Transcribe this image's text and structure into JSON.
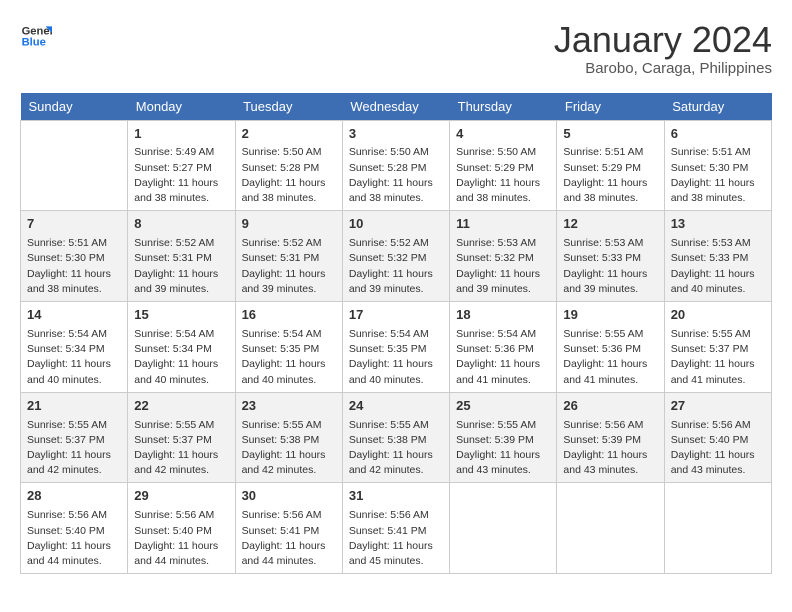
{
  "header": {
    "logo_line1": "General",
    "logo_line2": "Blue",
    "title": "January 2024",
    "subtitle": "Barobo, Caraga, Philippines"
  },
  "weekdays": [
    "Sunday",
    "Monday",
    "Tuesday",
    "Wednesday",
    "Thursday",
    "Friday",
    "Saturday"
  ],
  "weeks": [
    [
      {
        "day": "",
        "info": ""
      },
      {
        "day": "1",
        "info": "Sunrise: 5:49 AM\nSunset: 5:27 PM\nDaylight: 11 hours\nand 38 minutes."
      },
      {
        "day": "2",
        "info": "Sunrise: 5:50 AM\nSunset: 5:28 PM\nDaylight: 11 hours\nand 38 minutes."
      },
      {
        "day": "3",
        "info": "Sunrise: 5:50 AM\nSunset: 5:28 PM\nDaylight: 11 hours\nand 38 minutes."
      },
      {
        "day": "4",
        "info": "Sunrise: 5:50 AM\nSunset: 5:29 PM\nDaylight: 11 hours\nand 38 minutes."
      },
      {
        "day": "5",
        "info": "Sunrise: 5:51 AM\nSunset: 5:29 PM\nDaylight: 11 hours\nand 38 minutes."
      },
      {
        "day": "6",
        "info": "Sunrise: 5:51 AM\nSunset: 5:30 PM\nDaylight: 11 hours\nand 38 minutes."
      }
    ],
    [
      {
        "day": "7",
        "info": "Sunrise: 5:51 AM\nSunset: 5:30 PM\nDaylight: 11 hours\nand 38 minutes."
      },
      {
        "day": "8",
        "info": "Sunrise: 5:52 AM\nSunset: 5:31 PM\nDaylight: 11 hours\nand 39 minutes."
      },
      {
        "day": "9",
        "info": "Sunrise: 5:52 AM\nSunset: 5:31 PM\nDaylight: 11 hours\nand 39 minutes."
      },
      {
        "day": "10",
        "info": "Sunrise: 5:52 AM\nSunset: 5:32 PM\nDaylight: 11 hours\nand 39 minutes."
      },
      {
        "day": "11",
        "info": "Sunrise: 5:53 AM\nSunset: 5:32 PM\nDaylight: 11 hours\nand 39 minutes."
      },
      {
        "day": "12",
        "info": "Sunrise: 5:53 AM\nSunset: 5:33 PM\nDaylight: 11 hours\nand 39 minutes."
      },
      {
        "day": "13",
        "info": "Sunrise: 5:53 AM\nSunset: 5:33 PM\nDaylight: 11 hours\nand 40 minutes."
      }
    ],
    [
      {
        "day": "14",
        "info": "Sunrise: 5:54 AM\nSunset: 5:34 PM\nDaylight: 11 hours\nand 40 minutes."
      },
      {
        "day": "15",
        "info": "Sunrise: 5:54 AM\nSunset: 5:34 PM\nDaylight: 11 hours\nand 40 minutes."
      },
      {
        "day": "16",
        "info": "Sunrise: 5:54 AM\nSunset: 5:35 PM\nDaylight: 11 hours\nand 40 minutes."
      },
      {
        "day": "17",
        "info": "Sunrise: 5:54 AM\nSunset: 5:35 PM\nDaylight: 11 hours\nand 40 minutes."
      },
      {
        "day": "18",
        "info": "Sunrise: 5:54 AM\nSunset: 5:36 PM\nDaylight: 11 hours\nand 41 minutes."
      },
      {
        "day": "19",
        "info": "Sunrise: 5:55 AM\nSunset: 5:36 PM\nDaylight: 11 hours\nand 41 minutes."
      },
      {
        "day": "20",
        "info": "Sunrise: 5:55 AM\nSunset: 5:37 PM\nDaylight: 11 hours\nand 41 minutes."
      }
    ],
    [
      {
        "day": "21",
        "info": "Sunrise: 5:55 AM\nSunset: 5:37 PM\nDaylight: 11 hours\nand 42 minutes."
      },
      {
        "day": "22",
        "info": "Sunrise: 5:55 AM\nSunset: 5:37 PM\nDaylight: 11 hours\nand 42 minutes."
      },
      {
        "day": "23",
        "info": "Sunrise: 5:55 AM\nSunset: 5:38 PM\nDaylight: 11 hours\nand 42 minutes."
      },
      {
        "day": "24",
        "info": "Sunrise: 5:55 AM\nSunset: 5:38 PM\nDaylight: 11 hours\nand 42 minutes."
      },
      {
        "day": "25",
        "info": "Sunrise: 5:55 AM\nSunset: 5:39 PM\nDaylight: 11 hours\nand 43 minutes."
      },
      {
        "day": "26",
        "info": "Sunrise: 5:56 AM\nSunset: 5:39 PM\nDaylight: 11 hours\nand 43 minutes."
      },
      {
        "day": "27",
        "info": "Sunrise: 5:56 AM\nSunset: 5:40 PM\nDaylight: 11 hours\nand 43 minutes."
      }
    ],
    [
      {
        "day": "28",
        "info": "Sunrise: 5:56 AM\nSunset: 5:40 PM\nDaylight: 11 hours\nand 44 minutes."
      },
      {
        "day": "29",
        "info": "Sunrise: 5:56 AM\nSunset: 5:40 PM\nDaylight: 11 hours\nand 44 minutes."
      },
      {
        "day": "30",
        "info": "Sunrise: 5:56 AM\nSunset: 5:41 PM\nDaylight: 11 hours\nand 44 minutes."
      },
      {
        "day": "31",
        "info": "Sunrise: 5:56 AM\nSunset: 5:41 PM\nDaylight: 11 hours\nand 45 minutes."
      },
      {
        "day": "",
        "info": ""
      },
      {
        "day": "",
        "info": ""
      },
      {
        "day": "",
        "info": ""
      }
    ]
  ]
}
